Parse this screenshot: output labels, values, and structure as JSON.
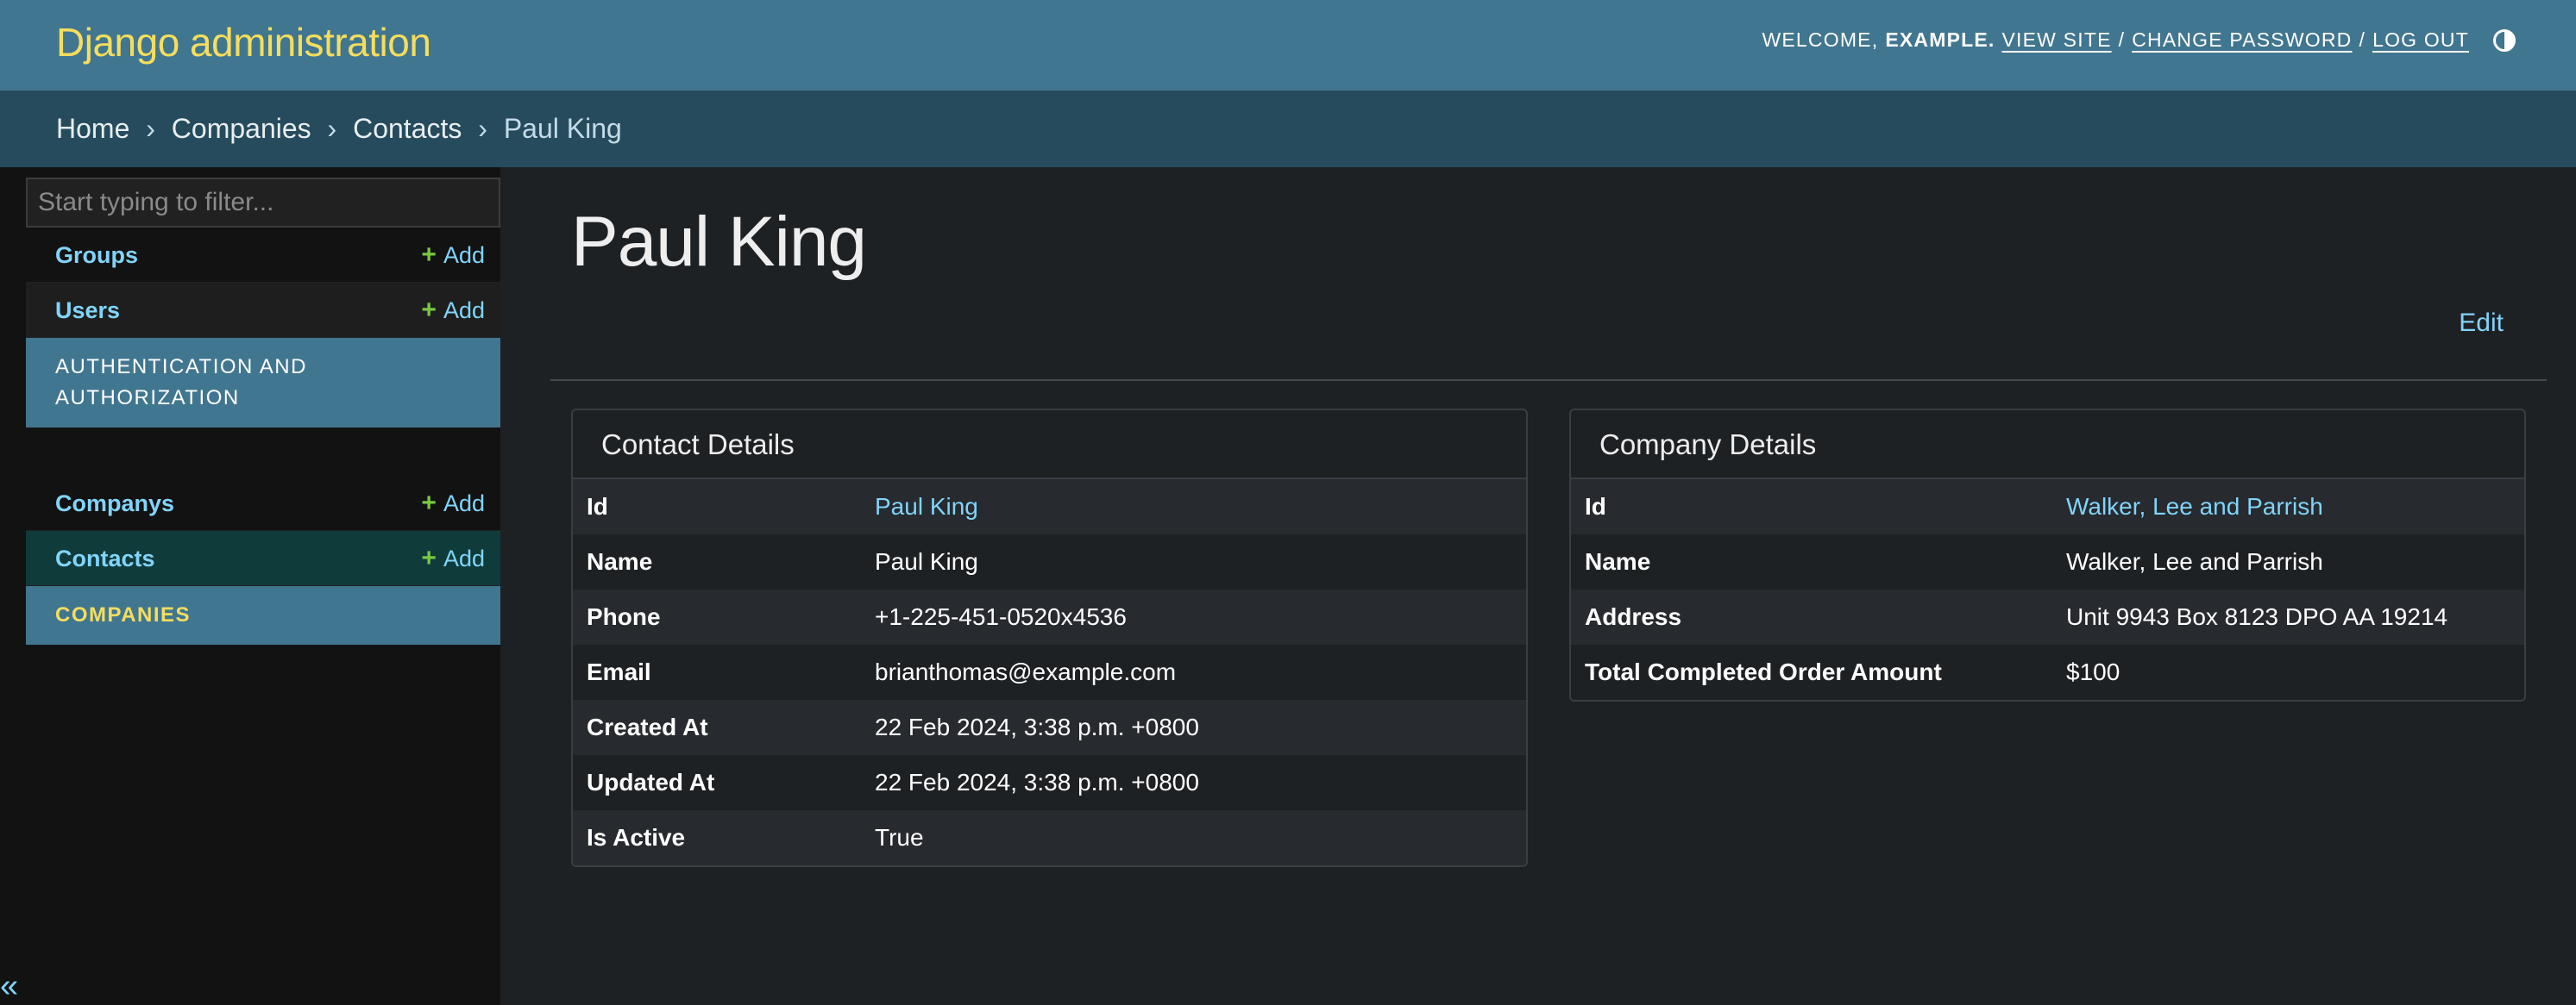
{
  "header": {
    "brand": "Django administration",
    "welcome_text": "Welcome,",
    "username": "example",
    "view_site": "View site",
    "change_password": "Change password",
    "log_out": "Log out",
    "separator": "/"
  },
  "breadcrumbs": {
    "home": "Home",
    "app": "Companies",
    "model": "Contacts",
    "current": "Paul King",
    "sep": "›"
  },
  "sidebar": {
    "filter_placeholder": "Start typing to filter...",
    "auth_items": [
      {
        "label": "Groups",
        "add": "Add"
      },
      {
        "label": "Users",
        "add": "Add"
      }
    ],
    "auth_caption": "Authentication and Authorization",
    "companies_items": [
      {
        "label": "Companys",
        "add": "Add"
      },
      {
        "label": "Contacts",
        "add": "Add"
      }
    ],
    "companies_caption": "Companies",
    "collapse_glyph": "«"
  },
  "main": {
    "title": "Paul King",
    "edit_label": "Edit",
    "contact_panel": {
      "title": "Contact Details",
      "rows": [
        {
          "label": "Id",
          "value": "Paul King"
        },
        {
          "label": "Name",
          "value": "Paul King"
        },
        {
          "label": "Phone",
          "value": "+1-225-451-0520x4536"
        },
        {
          "label": "Email",
          "value": "brianthomas@example.com"
        },
        {
          "label": "Created At",
          "value": "22 Feb 2024, 3:38 p.m. +0800"
        },
        {
          "label": "Updated At",
          "value": "22 Feb 2024, 3:38 p.m. +0800"
        },
        {
          "label": "Is Active",
          "value": "True"
        }
      ]
    },
    "company_panel": {
      "title": "Company Details",
      "rows": [
        {
          "label": "Id",
          "value": "Walker, Lee and Parrish"
        },
        {
          "label": "Name",
          "value": "Walker, Lee and Parrish"
        },
        {
          "label": "Address",
          "value": "Unit 9943 Box 8123 DPO AA 19214"
        },
        {
          "label": "Total Completed Order Amount",
          "value": "$100"
        }
      ]
    }
  },
  "colors": {
    "header_bg": "#417690",
    "breadcrumbs_bg": "#264b5d",
    "brand": "#f5dd5d",
    "link": "#81d4fa",
    "add_plus": "#79c83f",
    "page_bg": "#1e2124",
    "sidebar_bg": "#121212"
  },
  "icons": {
    "theme_toggle": "half-circle-icon",
    "add": "plus-icon",
    "collapse": "double-chevron-left-icon"
  }
}
